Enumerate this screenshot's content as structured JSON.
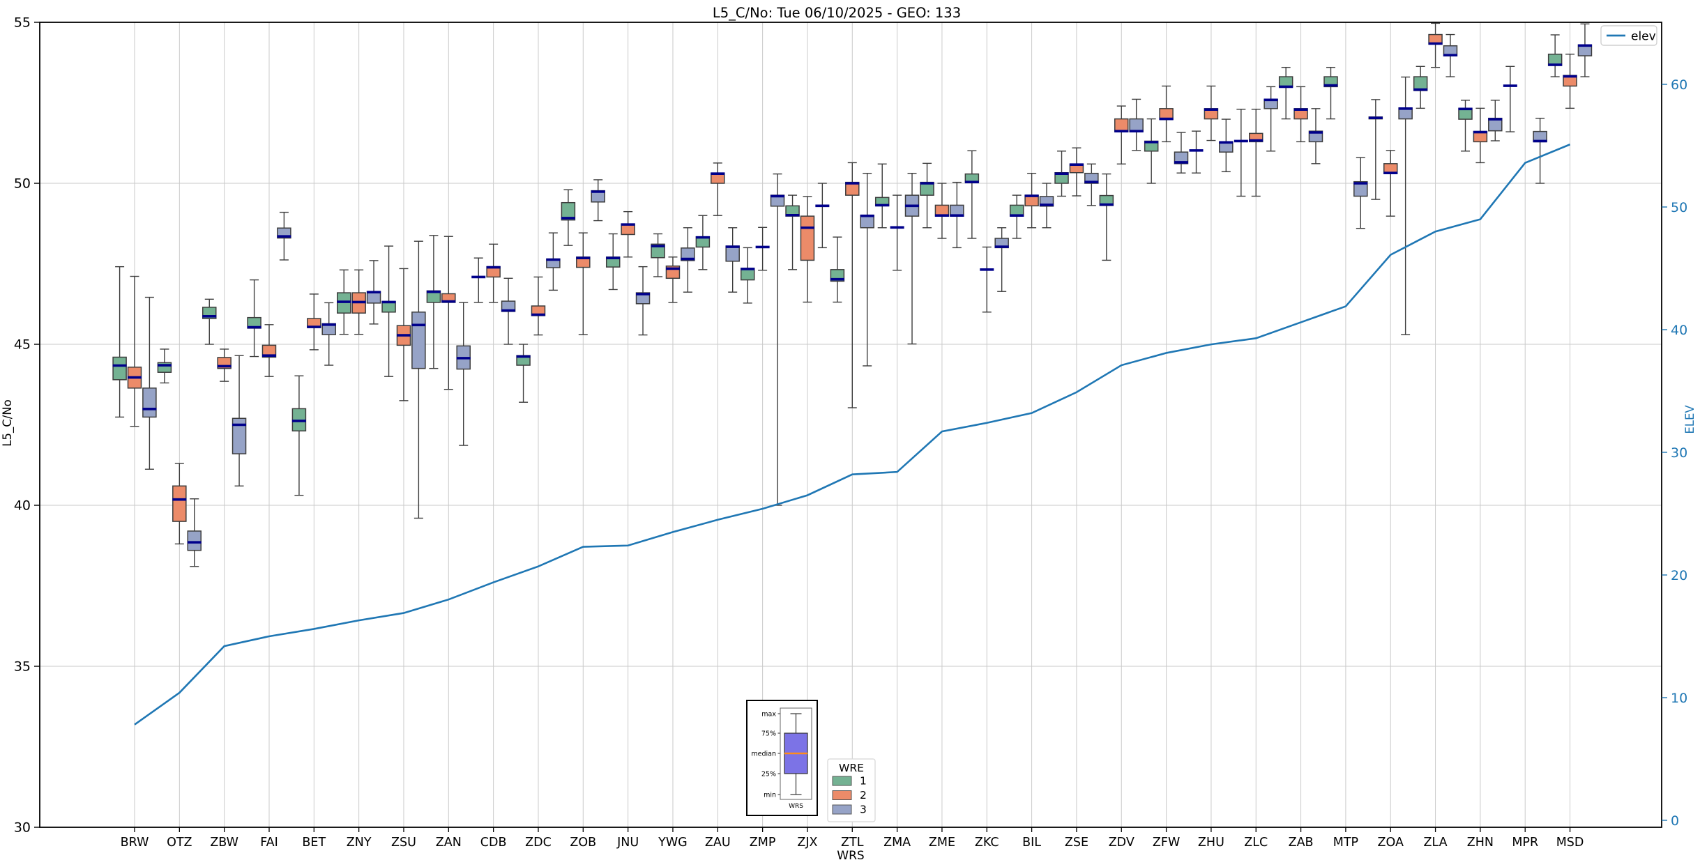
{
  "figure": {
    "title": "L5_C/No: Tue 06/10/2025 - GEO: 133",
    "xlabel": "WRS",
    "ylabel": "L5_C/No",
    "y2label": "ELEV"
  },
  "legend_elev": {
    "label": "elev"
  },
  "legend_wre": {
    "title": "WRE",
    "entries": [
      {
        "label": "1",
        "color": "#74b293"
      },
      {
        "label": "2",
        "color": "#ec8b69"
      },
      {
        "label": "3",
        "color": "#96a3c7"
      }
    ]
  },
  "inset": {
    "labels": [
      "max",
      "75%",
      "median",
      "25%",
      "min"
    ],
    "caption": "WRS",
    "box_color": "#7c73e6",
    "median_color": "#ff8c1a"
  },
  "colors": {
    "box_edge": "#3d3d3d",
    "whisker": "#3d3d3d",
    "median": "#00008b",
    "grid": "#cacaca",
    "spine": "#000000",
    "right_axis": "#1f77b4",
    "elev_line": "#1f77b4"
  },
  "chart_data": {
    "type": "boxplot+line",
    "title": "L5_C/No: Tue 06/10/2025 - GEO: 133",
    "xlabel": "WRS",
    "ylabel": "L5_C/No",
    "y2label": "ELEV",
    "ylim": [
      30,
      55
    ],
    "yticks": [
      30,
      35,
      40,
      45,
      50,
      55
    ],
    "y2ticks": [
      0,
      10,
      20,
      30,
      40,
      50,
      60
    ],
    "grid": true,
    "legend_position": "upper right",
    "box_stats_order": [
      "min",
      "q1",
      "median",
      "q3",
      "max"
    ],
    "categories": [
      "BRW",
      "OTZ",
      "ZBW",
      "FAI",
      "BET",
      "ZNY",
      "ZSU",
      "ZAN",
      "CDB",
      "ZDC",
      "ZOB",
      "JNU",
      "YWG",
      "ZAU",
      "ZMP",
      "ZJX",
      "ZTL",
      "ZMA",
      "ZME",
      "ZKC",
      "BIL",
      "ZSE",
      "ZDV",
      "ZFW",
      "ZHU",
      "ZLC",
      "ZAB",
      "MTP",
      "ZOA",
      "ZLA",
      "ZHN",
      "MPR",
      "MSD"
    ],
    "series": [
      {
        "name": "1",
        "color": "#74b293",
        "boxes": [
          [
            42.74,
            43.9,
            44.34,
            44.6,
            47.41
          ],
          [
            43.8,
            44.13,
            44.35,
            44.43,
            44.85
          ],
          [
            45.0,
            45.8,
            45.87,
            46.15,
            46.4
          ],
          [
            44.62,
            45.5,
            45.53,
            45.83,
            47.0
          ],
          [
            40.31,
            42.31,
            42.62,
            43.0,
            44.02
          ],
          [
            45.31,
            45.97,
            46.32,
            46.6,
            47.31
          ],
          [
            44.0,
            46.0,
            46.31,
            46.33,
            48.05
          ],
          [
            44.25,
            46.3,
            46.63,
            46.66,
            48.38
          ],
          [
            46.3,
            47.09,
            47.09,
            47.09,
            47.68
          ],
          [
            43.2,
            44.35,
            44.62,
            44.65,
            45.0
          ],
          [
            48.07,
            48.86,
            48.92,
            49.4,
            49.8
          ],
          [
            46.7,
            47.4,
            47.68,
            47.71,
            48.43
          ],
          [
            47.1,
            47.69,
            48.05,
            48.11,
            48.43
          ],
          [
            47.32,
            48.02,
            48.32,
            48.34,
            49.0
          ],
          [
            46.28,
            47.0,
            47.34,
            47.36,
            48.0
          ],
          [
            47.32,
            48.98,
            49.01,
            49.3,
            49.63
          ],
          [
            46.31,
            46.96,
            47.02,
            47.32,
            48.33
          ],
          [
            48.62,
            49.3,
            49.32,
            49.56,
            50.6
          ],
          [
            48.62,
            49.63,
            50.0,
            50.03,
            50.62
          ],
          [
            48.29,
            50.03,
            50.04,
            50.29,
            51.01
          ],
          [
            48.29,
            48.98,
            49.0,
            49.32,
            49.63
          ],
          [
            49.6,
            50.0,
            50.3,
            50.33,
            51.0
          ],
          [
            47.61,
            49.31,
            49.34,
            49.62,
            50.29
          ],
          [
            50.0,
            51.0,
            51.28,
            51.31,
            52.0
          ],
          [
            50.32,
            51.02,
            51.02,
            51.02,
            51.62
          ],
          [
            49.6,
            51.31,
            51.31,
            51.31,
            52.3
          ],
          [
            52.0,
            52.99,
            53.0,
            53.31,
            53.6
          ],
          [
            52.0,
            53.0,
            53.04,
            53.31,
            53.6
          ],
          [
            49.5,
            52.0,
            52.03,
            52.06,
            52.6
          ],
          [
            52.33,
            52.88,
            52.91,
            53.31,
            53.63
          ],
          [
            51.0,
            51.99,
            52.31,
            52.33,
            52.58
          ],
          [
            51.6,
            53.03,
            53.03,
            53.03,
            53.63
          ],
          [
            53.31,
            53.66,
            53.68,
            54.01,
            54.61
          ]
        ]
      },
      {
        "name": "2",
        "color": "#ec8b69",
        "boxes": [
          [
            42.45,
            43.64,
            43.97,
            44.29,
            47.11
          ],
          [
            38.8,
            39.5,
            40.18,
            40.6,
            41.3
          ],
          [
            43.85,
            44.25,
            44.32,
            44.59,
            44.85
          ],
          [
            44.0,
            44.6,
            44.65,
            44.97,
            45.61
          ],
          [
            44.83,
            45.52,
            45.54,
            45.8,
            46.56
          ],
          [
            45.31,
            45.97,
            46.31,
            46.6,
            47.31
          ],
          [
            43.25,
            44.97,
            45.28,
            45.58,
            47.35
          ],
          [
            43.6,
            46.3,
            46.33,
            46.57,
            48.35
          ],
          [
            46.3,
            47.09,
            47.39,
            47.41,
            48.11
          ],
          [
            45.29,
            45.89,
            45.92,
            46.19,
            47.09
          ],
          [
            45.3,
            47.39,
            47.68,
            47.71,
            48.46
          ],
          [
            47.71,
            48.41,
            48.72,
            48.74,
            49.12
          ],
          [
            46.3,
            47.05,
            47.35,
            47.43,
            47.71
          ],
          [
            49.0,
            50.0,
            50.3,
            50.32,
            50.63
          ],
          [
            47.3,
            48.02,
            48.02,
            48.02,
            48.63
          ],
          [
            46.31,
            47.61,
            48.62,
            48.98,
            49.59
          ],
          [
            43.03,
            49.63,
            50.0,
            50.03,
            50.64
          ],
          [
            47.3,
            48.63,
            48.63,
            48.63,
            49.63
          ],
          [
            48.29,
            48.98,
            49.0,
            49.32,
            50.0
          ],
          [
            46.0,
            47.32,
            47.32,
            47.32,
            48.02
          ],
          [
            48.62,
            49.3,
            49.61,
            49.63,
            50.31
          ],
          [
            49.61,
            50.33,
            50.58,
            50.6,
            51.1
          ],
          [
            50.6,
            51.6,
            51.62,
            52.0,
            52.4
          ],
          [
            51.29,
            51.98,
            52.0,
            52.32,
            53.02
          ],
          [
            51.33,
            52.0,
            52.29,
            52.32,
            53.02
          ],
          [
            49.6,
            51.29,
            51.33,
            51.55,
            52.3
          ],
          [
            51.29,
            52.0,
            52.29,
            52.32,
            53.0
          ],
          null,
          [
            48.98,
            50.3,
            50.32,
            50.61,
            51.02
          ],
          [
            53.6,
            54.32,
            54.34,
            54.62,
            54.97
          ],
          [
            50.64,
            51.29,
            51.59,
            51.61,
            52.33
          ],
          null,
          [
            52.33,
            53.02,
            53.32,
            53.35,
            54.01
          ]
        ]
      },
      {
        "name": "3",
        "color": "#96a3c7",
        "boxes": [
          [
            41.12,
            42.74,
            42.99,
            43.64,
            46.46
          ],
          [
            38.1,
            38.6,
            38.85,
            39.2,
            40.2
          ],
          [
            40.6,
            41.6,
            42.5,
            42.7,
            44.65
          ],
          [
            47.62,
            48.3,
            48.35,
            48.61,
            49.1
          ],
          [
            44.35,
            45.3,
            45.61,
            45.64,
            46.29
          ],
          [
            45.63,
            46.28,
            46.62,
            46.64,
            47.6
          ],
          [
            39.6,
            44.25,
            45.6,
            46.0,
            48.2
          ],
          [
            41.86,
            44.23,
            44.57,
            44.95,
            46.3
          ],
          [
            45.0,
            46.02,
            46.05,
            46.34,
            47.05
          ],
          [
            46.68,
            47.38,
            47.63,
            47.65,
            48.46
          ],
          [
            48.84,
            49.42,
            49.74,
            49.77,
            50.11
          ],
          [
            45.29,
            46.26,
            46.56,
            46.6,
            47.41
          ],
          [
            46.62,
            47.6,
            47.65,
            47.99,
            48.62
          ],
          [
            46.62,
            47.58,
            48.03,
            48.05,
            48.62
          ],
          [
            40.0,
            49.29,
            49.6,
            49.63,
            50.29
          ],
          [
            48.0,
            49.3,
            49.3,
            49.3,
            50.0
          ],
          [
            44.33,
            48.62,
            48.99,
            49.01,
            50.31
          ],
          [
            45.01,
            48.98,
            49.3,
            49.63,
            50.31
          ],
          [
            48.0,
            48.98,
            49.0,
            49.32,
            50.03
          ],
          [
            46.64,
            48.0,
            48.03,
            48.29,
            48.62
          ],
          [
            48.62,
            49.29,
            49.33,
            49.59,
            50.0
          ],
          [
            49.31,
            50.0,
            50.04,
            50.31,
            50.6
          ],
          [
            51.02,
            51.6,
            51.62,
            52.0,
            52.61
          ],
          [
            50.32,
            50.61,
            50.65,
            50.97,
            51.58
          ],
          [
            50.36,
            50.97,
            51.27,
            51.29,
            51.99
          ],
          [
            51.0,
            52.32,
            52.59,
            52.61,
            53.0
          ],
          [
            50.61,
            51.29,
            51.58,
            51.62,
            52.32
          ],
          [
            48.6,
            49.6,
            50.0,
            50.05,
            50.8
          ],
          [
            45.3,
            52.0,
            52.32,
            52.34,
            53.3
          ],
          [
            53.31,
            53.96,
            53.98,
            54.27,
            54.62
          ],
          [
            51.32,
            51.63,
            51.99,
            52.02,
            52.58
          ],
          [
            50.0,
            51.29,
            51.31,
            51.61,
            52.02
          ],
          [
            53.31,
            53.96,
            54.28,
            54.3,
            54.95
          ]
        ]
      }
    ],
    "line": {
      "name": "elev",
      "color": "#1f77b4",
      "axis": "right",
      "values": [
        7.8,
        10.4,
        14.2,
        15.0,
        15.6,
        16.3,
        16.9,
        18.0,
        19.4,
        20.7,
        22.3,
        22.4,
        23.5,
        24.5,
        25.4,
        26.5,
        28.2,
        28.4,
        31.7,
        32.4,
        33.2,
        34.9,
        37.1,
        38.1,
        38.8,
        39.3,
        40.6,
        41.9,
        46.1,
        48.0,
        49.0,
        53.6,
        55.1
      ]
    }
  }
}
